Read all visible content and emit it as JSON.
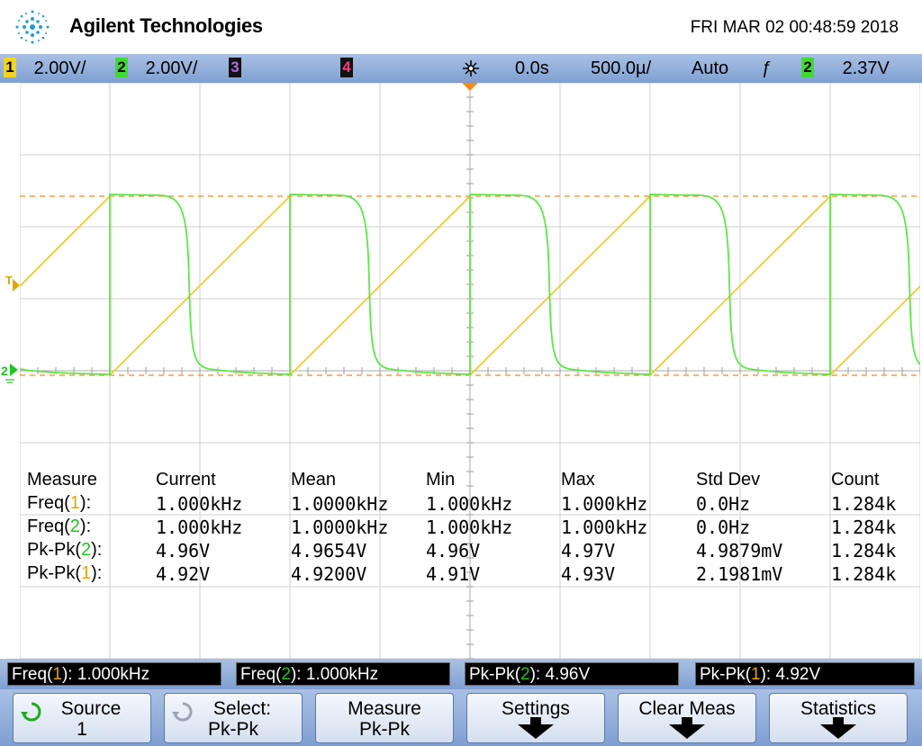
{
  "header": {
    "brand": "Agilent Technologies",
    "datetime": "FRI MAR 02 00:48:59 2018"
  },
  "status": {
    "ch1_num": "1",
    "ch1_scale": "2.00V/",
    "ch2_num": "2",
    "ch2_scale": "2.00V/",
    "ch3_num": "3",
    "ch4_num": "4",
    "delay": "0.0s",
    "timebase": "500.0µ/",
    "mode": "Auto",
    "trig_slope": "ƒ",
    "trig_src": "2",
    "trig_level": "2.37V"
  },
  "markers": {
    "trigger": "T",
    "ch2": "2"
  },
  "colors": {
    "ch1": "#f5c518",
    "ch2": "#5ee64a",
    "grid": "#cfcfcf",
    "bar": "#8fa9d8"
  },
  "measurements": {
    "headers": [
      "Measure",
      "Current",
      "Mean",
      "Min",
      "Max",
      "Std Dev",
      "Count"
    ],
    "rows": [
      {
        "name": "Freq",
        "ch": "1",
        "current": "1.000kHz",
        "mean": "1.0000kHz",
        "min": "1.000kHz",
        "max": "1.000kHz",
        "std": "0.0Hz",
        "count": "1.284k"
      },
      {
        "name": "Freq",
        "ch": "2",
        "current": "1.000kHz",
        "mean": "1.0000kHz",
        "min": "1.000kHz",
        "max": "1.000kHz",
        "std": "0.0Hz",
        "count": "1.284k"
      },
      {
        "name": "Pk-Pk",
        "ch": "2",
        "current": "4.96V",
        "mean": "4.9654V",
        "min": "4.96V",
        "max": "4.97V",
        "std": "4.9879mV",
        "count": "1.284k"
      },
      {
        "name": "Pk-Pk",
        "ch": "1",
        "current": "4.92V",
        "mean": "4.9200V",
        "min": "4.91V",
        "max": "4.93V",
        "std": "2.1981mV",
        "count": "1.284k"
      }
    ]
  },
  "meas_bar": [
    {
      "name": "Freq",
      "ch": "1",
      "value": "1.000kHz"
    },
    {
      "name": "Freq",
      "ch": "2",
      "value": "1.000kHz"
    },
    {
      "name": "Pk-Pk",
      "ch": "2",
      "value": "4.96V"
    },
    {
      "name": "Pk-Pk",
      "ch": "1",
      "value": "4.92V"
    }
  ],
  "softkeys": [
    {
      "l1": "Source",
      "l2": "1"
    },
    {
      "l1": "Select:",
      "l2": "Pk-Pk"
    },
    {
      "l1": "Measure",
      "l2": "Pk-Pk"
    },
    {
      "l1": "Settings",
      "l2": ""
    },
    {
      "l1": "Clear Meas",
      "l2": ""
    },
    {
      "l1": "Statistics",
      "l2": ""
    }
  ]
}
